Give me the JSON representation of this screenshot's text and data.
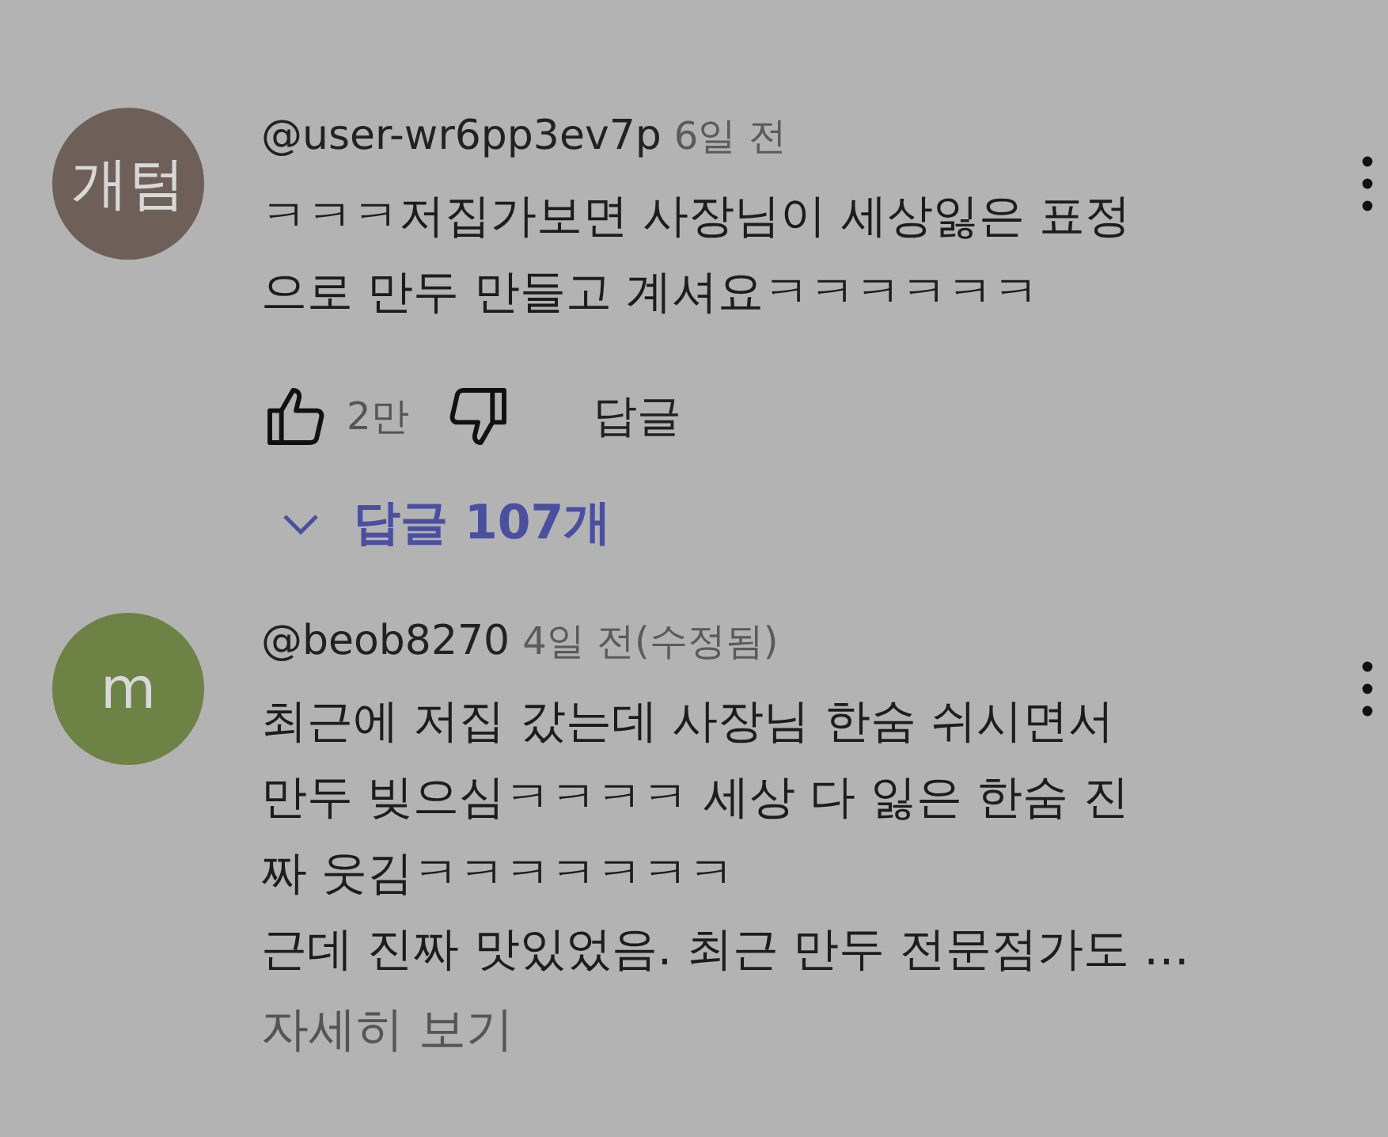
{
  "comments": [
    {
      "avatar": {
        "initials": "개텀",
        "color": "#6e6059"
      },
      "author": "@user-wr6pp3ev7p",
      "time": "6일 전",
      "lines": [
        "ㅋㅋㅋ저집가보면 사장님이 세상잃은 표정",
        "으로 만두 만들고 계셔요ㅋㅋㅋㅋㅋㅋ"
      ],
      "likes": "2만",
      "reply_label": "답글",
      "replies_toggle": "답글 107개"
    },
    {
      "avatar": {
        "initials": "m",
        "color": "#6d8245"
      },
      "author": "@beob8270",
      "time": "4일 전(수정됨)",
      "lines": [
        "최근에 저집 갔는데 사장님 한숨 쉬시면서",
        "만두 빚으심ㅋㅋㅋㅋ 세상 다 잃은 한숨 진",
        "짜 웃김ㅋㅋㅋㅋㅋㅋㅋ",
        "근데 진짜 맛있었음. 최근 만두 전문점가도 …"
      ],
      "read_more": "자세히 보기"
    }
  ]
}
